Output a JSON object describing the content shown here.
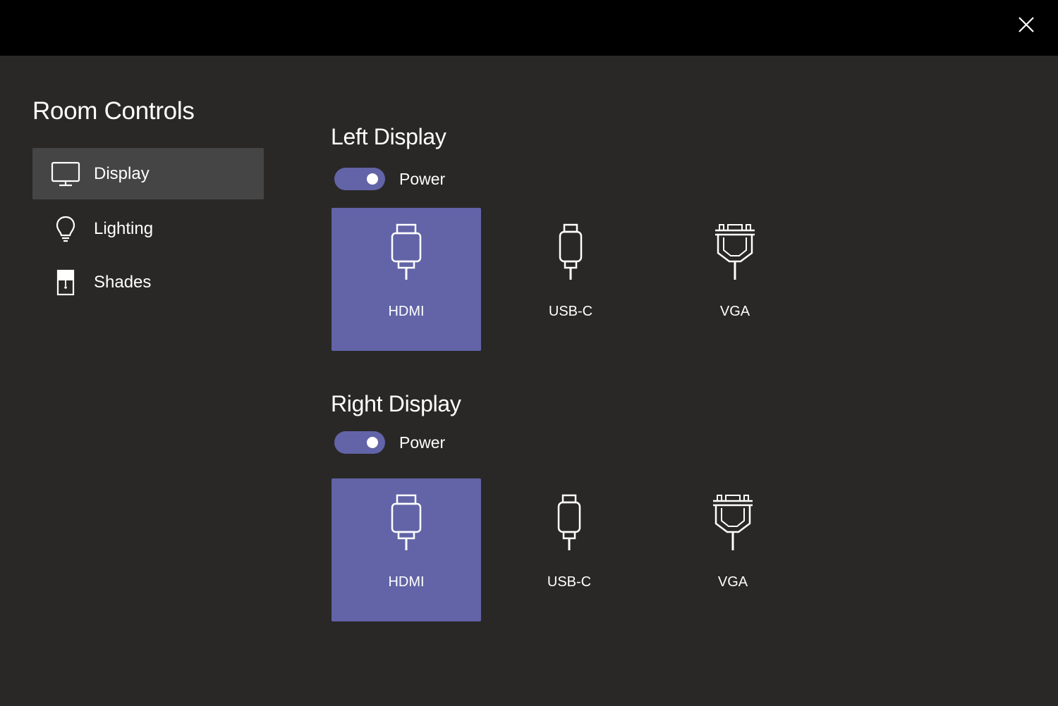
{
  "window": {
    "close_icon": "close-icon"
  },
  "sidebar": {
    "title": "Room Controls",
    "items": [
      {
        "label": "Display",
        "icon": "monitor-icon",
        "active": true
      },
      {
        "label": "Lighting",
        "icon": "lightbulb-icon",
        "active": false
      },
      {
        "label": "Shades",
        "icon": "shades-icon",
        "active": false
      }
    ]
  },
  "left_display": {
    "title": "Left Display",
    "power_label": "Power",
    "power_on": true,
    "inputs": [
      {
        "label": "HDMI",
        "icon": "hdmi-icon",
        "selected": true
      },
      {
        "label": "USB-C",
        "icon": "usb-c-icon",
        "selected": false
      },
      {
        "label": "VGA",
        "icon": "vga-icon",
        "selected": false
      }
    ]
  },
  "right_display": {
    "title": "Right Display",
    "power_label": "Power",
    "power_on": true,
    "inputs": [
      {
        "label": "HDMI",
        "icon": "hdmi-icon",
        "selected": true
      },
      {
        "label": "USB-C",
        "icon": "usb-c-icon",
        "selected": false
      },
      {
        "label": "VGA",
        "icon": "vga-icon",
        "selected": false
      }
    ]
  },
  "colors": {
    "background": "#292827",
    "topbar": "#000000",
    "accent": "#6264a7",
    "nav_active": "#464545"
  }
}
